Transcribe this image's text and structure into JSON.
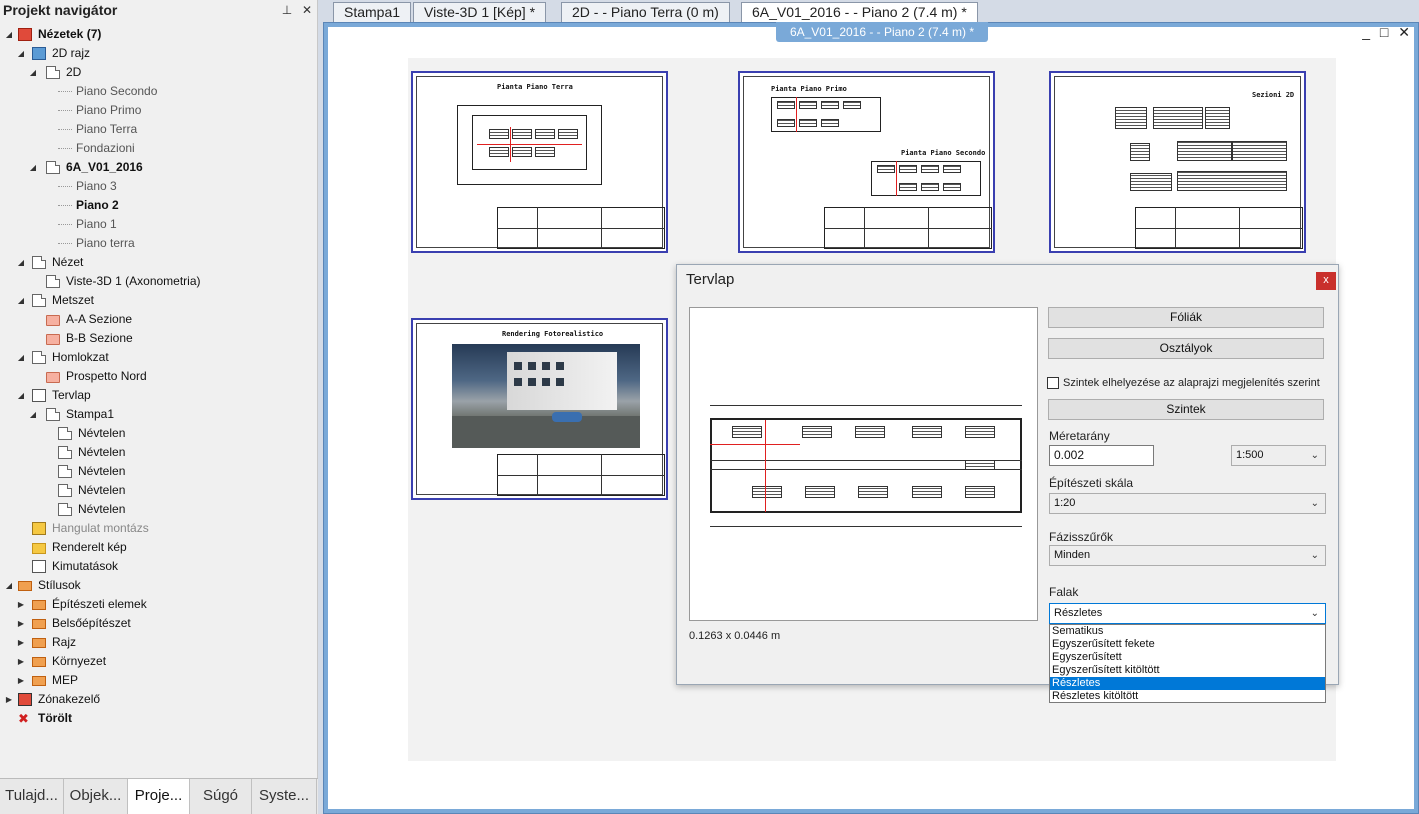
{
  "navigator": {
    "title": "Projekt navigátor",
    "pin_glyph": "⊥",
    "close_glyph": "✕",
    "tree": [
      {
        "label": "Nézetek (7)",
        "level": 0,
        "bold": true,
        "expanded": true,
        "icon": "views-icon"
      },
      {
        "label": "2D rajz",
        "level": 1,
        "expanded": true,
        "icon": "2d-drawing-icon"
      },
      {
        "label": "2D",
        "level": 2,
        "expanded": true,
        "icon": "page-icon"
      },
      {
        "label": "Piano Secondo",
        "level": 3,
        "dim": true
      },
      {
        "label": "Piano Primo",
        "level": 3,
        "dim": true
      },
      {
        "label": "Piano Terra",
        "level": 3,
        "dim": true
      },
      {
        "label": "Fondazioni",
        "level": 3,
        "dim": true
      },
      {
        "label": "6A_V01_2016",
        "level": 2,
        "bold": true,
        "expanded": true,
        "icon": "page-icon"
      },
      {
        "label": "Piano 3",
        "level": 3,
        "dim": true
      },
      {
        "label": "Piano 2",
        "level": 3,
        "bold": true
      },
      {
        "label": "Piano 1",
        "level": 3,
        "dim": true
      },
      {
        "label": "Piano terra",
        "level": 3,
        "dim": true
      },
      {
        "label": "Nézet",
        "level": 1,
        "expanded": true,
        "icon": "page-icon"
      },
      {
        "label": "Viste-3D 1 (Axonometria)",
        "level": 2,
        "icon": "page-icon"
      },
      {
        "label": "Metszet",
        "level": 1,
        "expanded": true,
        "icon": "page-icon"
      },
      {
        "label": "A-A Sezione",
        "level": 2,
        "icon": "section-folder-icon"
      },
      {
        "label": "B-B Sezione",
        "level": 2,
        "icon": "section-folder-icon"
      },
      {
        "label": "Homlokzat",
        "level": 1,
        "expanded": true,
        "icon": "page-icon"
      },
      {
        "label": "Prospetto Nord",
        "level": 2,
        "icon": "section-folder-icon"
      },
      {
        "label": "Tervlap",
        "level": 1,
        "expanded": true,
        "icon": "layout-icon"
      },
      {
        "label": "Stampa1",
        "level": 2,
        "expanded": true,
        "icon": "page-icon"
      },
      {
        "label": "Névtelen",
        "level": 3,
        "icon": "page-icon"
      },
      {
        "label": "Névtelen",
        "level": 3,
        "icon": "page-icon"
      },
      {
        "label": "Névtelen",
        "level": 3,
        "icon": "page-icon"
      },
      {
        "label": "Névtelen",
        "level": 3,
        "icon": "page-icon"
      },
      {
        "label": "Névtelen",
        "level": 3,
        "icon": "page-icon"
      },
      {
        "label": "Hangulat montázs",
        "level": 1,
        "gray": true,
        "icon": "mood-montage-icon"
      },
      {
        "label": "Renderelt kép",
        "level": 1,
        "icon": "render-folder-icon"
      },
      {
        "label": "Kimutatások",
        "level": 1,
        "icon": "report-icon"
      },
      {
        "label": "Stílusok",
        "level": 0,
        "expanded": true,
        "icon": "styles-icon"
      },
      {
        "label": "Építészeti elemek",
        "level": 1,
        "collapsed": true,
        "icon": "styles-icon"
      },
      {
        "label": "Belsőépítészet",
        "level": 1,
        "collapsed": true,
        "icon": "styles-icon"
      },
      {
        "label": "Rajz",
        "level": 1,
        "collapsed": true,
        "icon": "styles-icon"
      },
      {
        "label": "Környezet",
        "level": 1,
        "collapsed": true,
        "icon": "styles-icon"
      },
      {
        "label": "MEP",
        "level": 1,
        "collapsed": true,
        "icon": "styles-icon"
      },
      {
        "label": "Zónakezelő",
        "level": 0,
        "collapsed": true,
        "icon": "zone-manager-icon"
      },
      {
        "label": "Törölt",
        "level": 0,
        "bold": true,
        "icon": "deleted-x-icon"
      }
    ],
    "bottom_tabs": [
      {
        "label": "Tulajd...",
        "active": false
      },
      {
        "label": "Objek...",
        "active": false
      },
      {
        "label": "Proje...",
        "active": true
      },
      {
        "label": "Súgó",
        "active": false
      },
      {
        "label": "Syste...",
        "active": false
      }
    ]
  },
  "document_tabs": [
    {
      "label": "Stampa1",
      "active": false
    },
    {
      "label": "Viste-3D 1 [Kép] *",
      "active": false
    },
    {
      "label": "2D -  - Piano Terra (0 m)",
      "active": false
    },
    {
      "label": "6A_V01_2016 -  - Piano 2 (7.4 m) *",
      "active": true
    }
  ],
  "window": {
    "caption": "6A_V01_2016 -  - Piano 2 (7.4 m) *",
    "buttons": "_ □ ✕"
  },
  "sheets": [
    {
      "title": "Pianta Piano Terra"
    },
    {
      "title": "Pianta Piano Primo",
      "title2": "Pianta Piano Secondo"
    },
    {
      "title": "Sezioni 2D"
    },
    {
      "title": "Rendering Fotorealistico"
    }
  ],
  "dialog": {
    "title": "Tervlap",
    "close_glyph": "x",
    "dimensions": "0.1263 x 0.0446 m",
    "btn_layers": "Fóliák",
    "btn_classes": "Osztályok",
    "checkbox_label": "Szintek elhelyezése az alaprajzi megjelenítés szerint",
    "checkbox_checked": false,
    "btn_levels": "Szintek",
    "scale_label": "Méretarány",
    "scale_value": "0.002",
    "scale_select": "1:500",
    "arch_scale_label": "Építészeti skála",
    "arch_scale_value": "1:20",
    "phase_label": "Fázisszűrők",
    "phase_value": "Minden",
    "walls_label": "Falak",
    "walls_value": "Részletes",
    "walls_options": [
      {
        "label": "Sematikus",
        "selected": false
      },
      {
        "label": "Egyszerűsített fekete",
        "selected": false
      },
      {
        "label": "Egyszerűsített",
        "selected": false
      },
      {
        "label": "Egyszerűsített kitöltött",
        "selected": false
      },
      {
        "label": "Részletes",
        "selected": true
      },
      {
        "label": "Részletes kitöltött",
        "selected": false
      }
    ]
  }
}
